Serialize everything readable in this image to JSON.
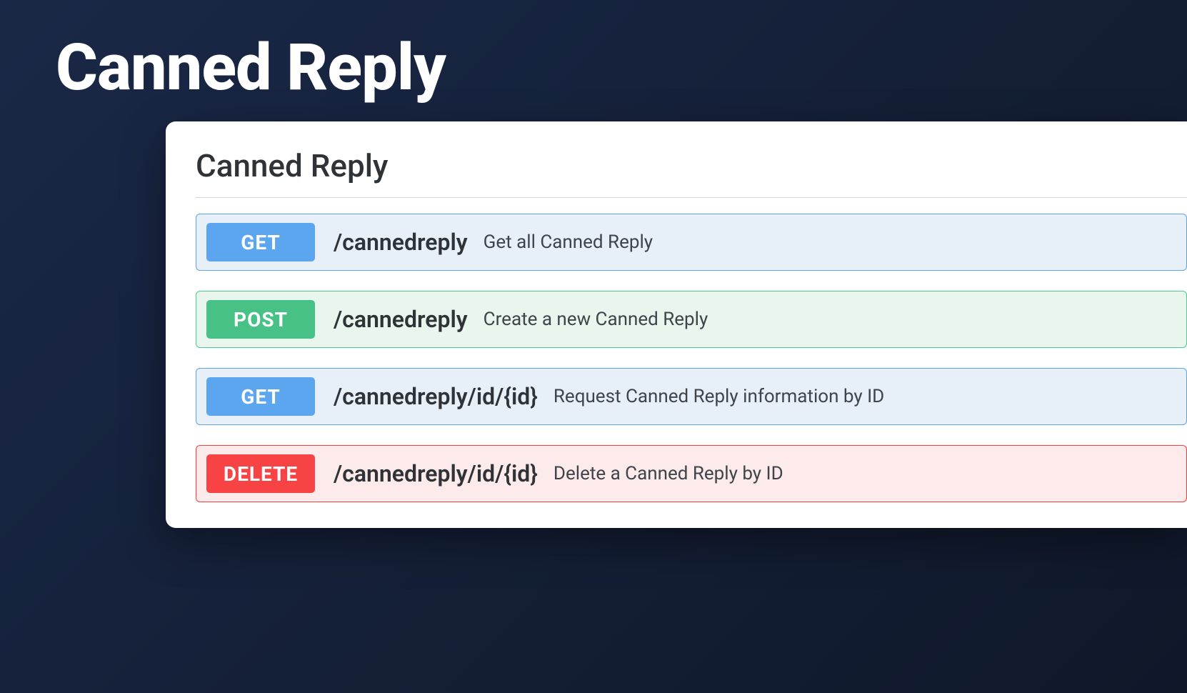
{
  "header": {
    "title": "Canned Reply"
  },
  "panel": {
    "section_title": "Canned Reply",
    "endpoints": [
      {
        "method": "GET",
        "method_key": "get",
        "path": "/cannedreply",
        "description": "Get all Canned Reply"
      },
      {
        "method": "POST",
        "method_key": "post",
        "path": "/cannedreply",
        "description": "Create a new Canned Reply"
      },
      {
        "method": "GET",
        "method_key": "get",
        "path": "/cannedreply/id/{id}",
        "description": "Request Canned Reply information by ID"
      },
      {
        "method": "DELETE",
        "method_key": "delete",
        "path": "/cannedreply/id/{id}",
        "description": "Delete a Canned Reply by ID"
      }
    ]
  }
}
